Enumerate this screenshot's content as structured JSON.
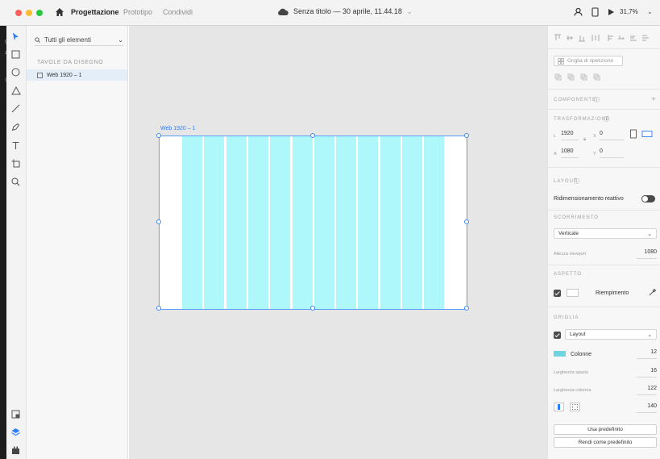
{
  "titlebar": {
    "traffic_colors": [
      "#fe5f57",
      "#febc2e",
      "#28c840"
    ],
    "tabs": [
      {
        "label": "Progettazione",
        "active": true
      },
      {
        "label": "Prototipo",
        "active": false
      },
      {
        "label": "Condividi",
        "active": false
      }
    ],
    "document_title": "Senza titolo — 30 aprile, 11.44.18",
    "zoom": "31,7%",
    "icons": [
      "home-icon",
      "cloud-icon",
      "user-icon",
      "mobile-preview-icon",
      "play-icon"
    ]
  },
  "tools": [
    "select-tool-icon",
    "rectangle-tool-icon",
    "ellipse-tool-icon",
    "polygon-tool-icon",
    "line-tool-icon",
    "pen-tool-icon",
    "text-tool-icon",
    "artboard-tool-icon",
    "zoom-tool-icon"
  ],
  "bottom_tools": [
    "assets-icon",
    "layers-icon",
    "plugins-icon"
  ],
  "layers": {
    "filter_label": "Tutti gli elementi",
    "section_title": "TAVOLE DA DISEGNO",
    "items": [
      {
        "label": "Web 1920 – 1",
        "selected": true
      }
    ]
  },
  "canvas": {
    "artboard_name": "Web 1920 – 1",
    "column_count": 12,
    "colors": {
      "canvas": "#e6e6e6",
      "column": "#aef8fc",
      "selection": "#3d8cf7"
    }
  },
  "props": {
    "repeat_grid_label": "Griglia di ripetizione",
    "component_title": "COMPONENTE",
    "transform": {
      "title": "TRASFORMAZIONE",
      "w_label": "L",
      "w_value": "1920",
      "h_label": "A",
      "h_value": "1080",
      "x_label": "X",
      "x_value": "0",
      "y_label": "Y",
      "y_value": "0"
    },
    "layout": {
      "title": "LAYOUT",
      "responsive_label": "Ridimensionamento reattivo",
      "responsive_on": false
    },
    "scroll": {
      "title": "SCORRIMENTO",
      "value": "Verticale",
      "viewport_label": "Altezza viewport",
      "viewport_value": "1080"
    },
    "appearance": {
      "title": "ASPETTO",
      "fill_label": "Riempimento",
      "fill_checked": true
    },
    "grid": {
      "title": "GRIGLIA",
      "type": "Layout",
      "columns_label": "Colonne",
      "columns_value": "12",
      "gutter_label": "Larghezza spazio",
      "gutter_value": "16",
      "column_width_label": "Larghezza colonna",
      "column_width_value": "122",
      "margin_value": "140",
      "use_default_label": "Usa predefinito",
      "make_default_label": "Rendi come predefinito"
    }
  }
}
